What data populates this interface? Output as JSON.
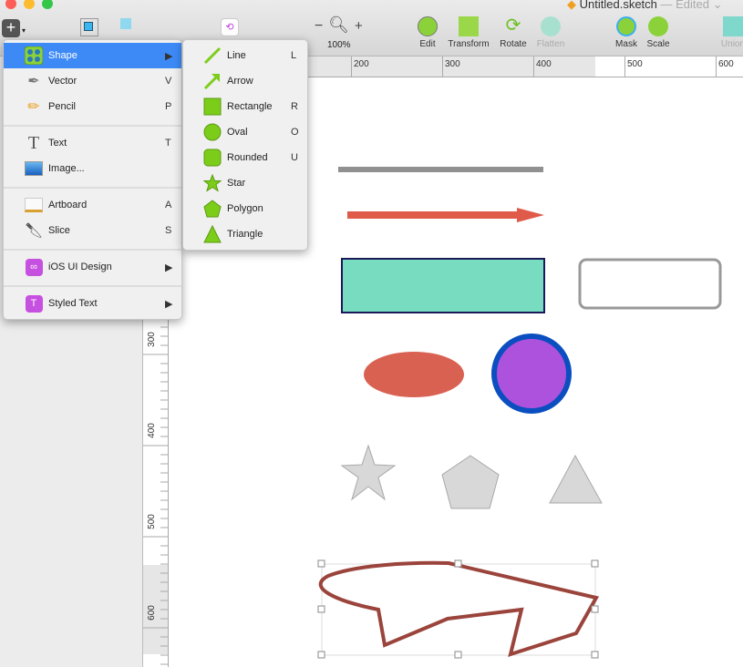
{
  "window": {
    "title": "Untitled.sketch",
    "status": "— Edited ⌄"
  },
  "toolbar": {
    "zoom": "100%",
    "zoom_minus": "−",
    "zoom_plus": "+",
    "buttons": [
      {
        "label": "Edit",
        "enabled": true
      },
      {
        "label": "Transform",
        "enabled": true
      },
      {
        "label": "Rotate",
        "enabled": true
      },
      {
        "label": "Flatten",
        "enabled": false
      },
      {
        "label": "Mask",
        "enabled": true
      },
      {
        "label": "Scale",
        "enabled": true
      },
      {
        "label": "Union",
        "enabled": false
      }
    ]
  },
  "insert_menu": {
    "items": [
      {
        "label": "Shape",
        "shortcut": "",
        "submenu": true,
        "icon": "shape-grid-icon",
        "highlighted": true
      },
      {
        "label": "Vector",
        "shortcut": "V",
        "icon": "pen-icon"
      },
      {
        "label": "Pencil",
        "shortcut": "P",
        "icon": "pencil-icon"
      },
      {
        "label": "Text",
        "shortcut": "T",
        "icon": "text-icon"
      },
      {
        "label": "Image...",
        "shortcut": "",
        "icon": "image-icon"
      },
      {
        "label": "Artboard",
        "shortcut": "A",
        "icon": "artboard-icon"
      },
      {
        "label": "Slice",
        "shortcut": "S",
        "icon": "knife-icon"
      },
      {
        "label": "iOS UI Design",
        "shortcut": "",
        "submenu": true,
        "icon": "ios-icon"
      },
      {
        "label": "Styled Text",
        "shortcut": "",
        "submenu": true,
        "icon": "styled-text-icon"
      }
    ]
  },
  "shape_submenu": {
    "items": [
      {
        "label": "Line",
        "shortcut": "L"
      },
      {
        "label": "Arrow",
        "shortcut": ""
      },
      {
        "label": "Rectangle",
        "shortcut": "R"
      },
      {
        "label": "Oval",
        "shortcut": "O"
      },
      {
        "label": "Rounded",
        "shortcut": "U"
      },
      {
        "label": "Star",
        "shortcut": ""
      },
      {
        "label": "Polygon",
        "shortcut": ""
      },
      {
        "label": "Triangle",
        "shortcut": ""
      }
    ]
  },
  "rulers": {
    "horizontal": [
      "200",
      "300",
      "400",
      "500",
      "600"
    ],
    "vertical": [
      "300",
      "400",
      "500",
      "600"
    ]
  },
  "colors": {
    "accent": "#3d8af7",
    "line": "#909090",
    "arrow": "#e05a4a",
    "rect_fill": "#78dcc0",
    "oval": "#d96152",
    "circle_fill": "#ad52dd",
    "circle_stroke": "#0a4ec0",
    "path": "#9a443c",
    "shape_green": "#7ccd1a"
  }
}
